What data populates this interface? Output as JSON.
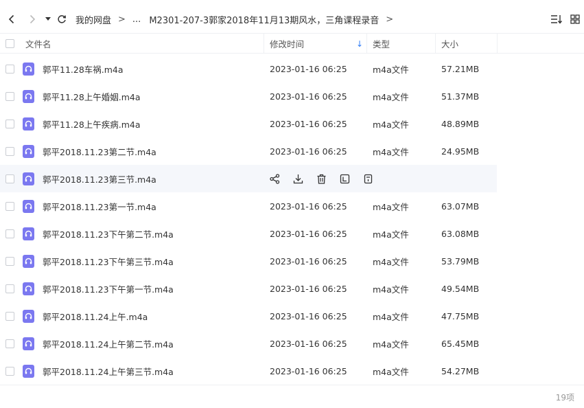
{
  "breadcrumb": {
    "root": "我的网盘",
    "ellipsis": "...",
    "current": "M2301-207-3郭家2018年11月13期风水，三角课程录音"
  },
  "columns": {
    "name": "文件名",
    "modified": "修改时间",
    "type": "类型",
    "size": "大小"
  },
  "files": [
    {
      "name": "郭平11.28车祸.m4a",
      "modified": "2023-01-16 06:25",
      "type": "m4a文件",
      "size": "57.21MB"
    },
    {
      "name": "郭平11.28上午婚姻.m4a",
      "modified": "2023-01-16 06:25",
      "type": "m4a文件",
      "size": "51.37MB"
    },
    {
      "name": "郭平11.28上午疾病.m4a",
      "modified": "2023-01-16 06:25",
      "type": "m4a文件",
      "size": "48.89MB"
    },
    {
      "name": "郭平2018.11.23第二节.m4a",
      "modified": "2023-01-16 06:25",
      "type": "m4a文件",
      "size": "24.95MB"
    },
    {
      "name": "郭平2018.11.23第三节.m4a",
      "modified": "",
      "type": "",
      "size": ""
    },
    {
      "name": "郭平2018.11.23第一节.m4a",
      "modified": "2023-01-16 06:25",
      "type": "m4a文件",
      "size": "63.07MB"
    },
    {
      "name": "郭平2018.11.23下午第二节.m4a",
      "modified": "2023-01-16 06:25",
      "type": "m4a文件",
      "size": "63.08MB"
    },
    {
      "name": "郭平2018.11.23下午第三节.m4a",
      "modified": "2023-01-16 06:25",
      "type": "m4a文件",
      "size": "53.79MB"
    },
    {
      "name": "郭平2018.11.23下午第一节.m4a",
      "modified": "2023-01-16 06:25",
      "type": "m4a文件",
      "size": "49.54MB"
    },
    {
      "name": "郭平2018.11.24上午.m4a",
      "modified": "2023-01-16 06:25",
      "type": "m4a文件",
      "size": "47.75MB"
    },
    {
      "name": "郭平2018.11.24上午第二节.m4a",
      "modified": "2023-01-16 06:25",
      "type": "m4a文件",
      "size": "65.45MB"
    },
    {
      "name": "郭平2018.11.24上午第三节.m4a",
      "modified": "2023-01-16 06:25",
      "type": "m4a文件",
      "size": "54.27MB"
    }
  ],
  "footer": {
    "count": "19项"
  },
  "colors": {
    "accent": "#2f7cf6",
    "file_icon": "#7b78f0",
    "hover_row": "#f5f7fb"
  },
  "icons": {
    "back": "chevron-left-icon",
    "forward": "chevron-right-icon",
    "history": "caret-down-icon",
    "refresh": "refresh-icon",
    "sort": "sort-icon",
    "grid": "grid-view-icon",
    "row_actions": [
      "share-icon",
      "download-icon",
      "delete-icon",
      "rename-icon",
      "more-icon"
    ]
  }
}
